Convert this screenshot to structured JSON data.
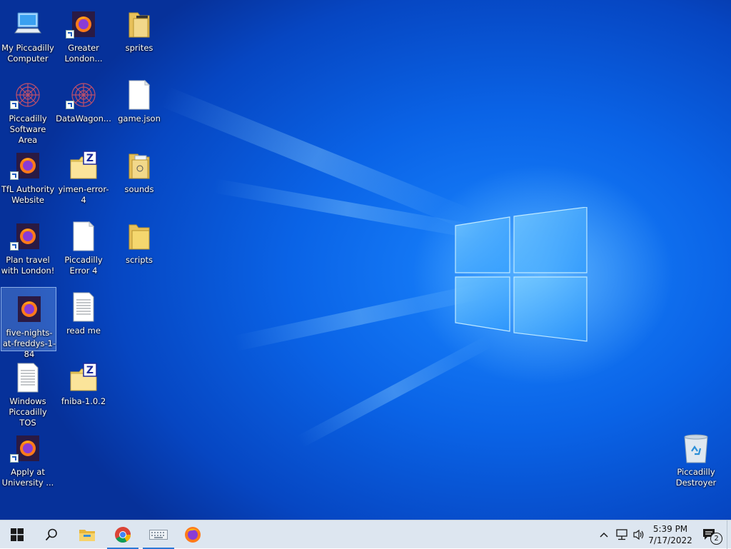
{
  "desktop": {
    "icons": [
      {
        "label": "My Piccadilly Computer",
        "kind": "computer"
      },
      {
        "label": "Greater London...",
        "kind": "firefox"
      },
      {
        "label": "sprites",
        "kind": "folder-docs"
      },
      {
        "label": "Piccadilly Software Area",
        "kind": "flower"
      },
      {
        "label": "DataWagon...",
        "kind": "flower"
      },
      {
        "label": "game.json",
        "kind": "file"
      },
      {
        "label": "TfL Authority Website",
        "kind": "firefox"
      },
      {
        "label": "yimen-error-4",
        "kind": "zip"
      },
      {
        "label": "sounds",
        "kind": "folder-docs"
      },
      {
        "label": "Plan travel with London!",
        "kind": "firefox"
      },
      {
        "label": "Piccadilly Error 4",
        "kind": "file"
      },
      {
        "label": "scripts",
        "kind": "folder"
      },
      {
        "label": "five-nights-at-freddys-1-84",
        "kind": "firefox"
      },
      {
        "label": "read me",
        "kind": "text"
      },
      {
        "label": "Windows Piccadilly TOS",
        "kind": "text"
      },
      {
        "label": "fniba-1.0.2",
        "kind": "zip"
      },
      {
        "label": "Apply at University ...",
        "kind": "firefox"
      },
      {
        "label": "Piccadilly Destroyer",
        "kind": "recycle-bin"
      }
    ]
  },
  "taskbar": {
    "start_icon": "windows-start-icon",
    "search_icon": "search-icon",
    "pinned": [
      "file-explorer-icon",
      "chrome-icon",
      "keyboard-app-icon",
      "firefox-icon"
    ],
    "clock": {
      "time": "5:39 PM",
      "date": "7/17/2022"
    },
    "notification_count": "2"
  },
  "colors": {
    "desktop_blue": "#0a63e6",
    "taskbar_bg": "#dde6f0",
    "accent": "#2b78d6"
  }
}
